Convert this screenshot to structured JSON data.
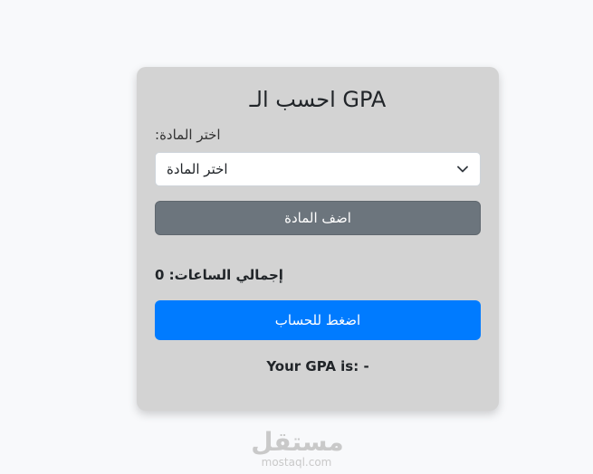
{
  "card": {
    "title": "احسب الـ GPA",
    "subject_label": ":اختر المادة",
    "subject_select": {
      "selected": "اختر المادة"
    },
    "add_button": "اضف المادة",
    "total_hours": "إجمالي الساعات: 0",
    "calc_button": "اضغط للحساب",
    "gpa_result": "Your GPA is: -"
  },
  "watermark": {
    "arabic": "مستقل",
    "latin": "mostaql.com"
  },
  "colors": {
    "page_bg": "#f8f9fb",
    "card_bg": "#d3d3d3",
    "add_button": "#6c757d",
    "calc_button": "#007bff"
  }
}
